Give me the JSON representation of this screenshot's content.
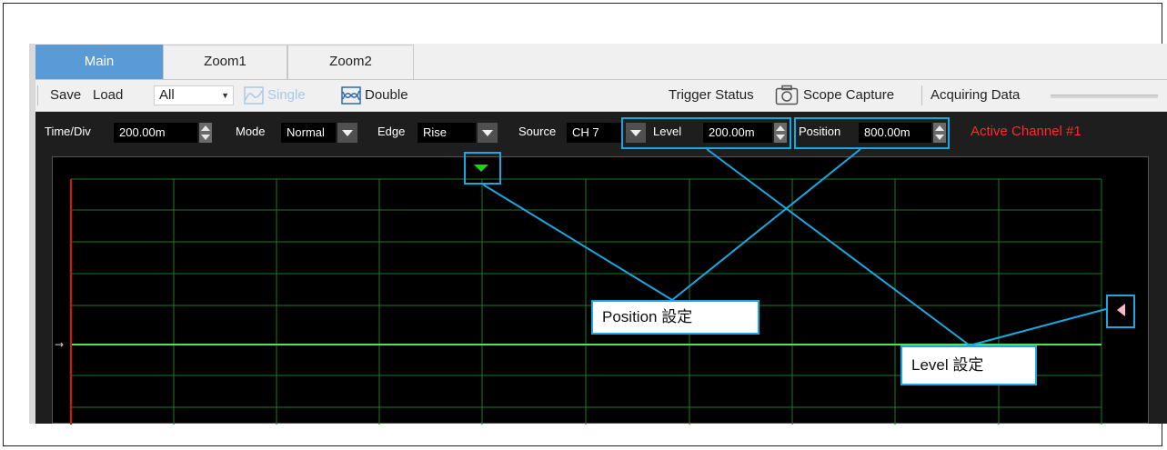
{
  "tabs": [
    "Main",
    "Zoom1",
    "Zoom2"
  ],
  "toolbar": {
    "save": "Save",
    "load": "Load",
    "load_filter": "All",
    "single": "Single",
    "double": "Double",
    "trigger_status": "Trigger Status",
    "scope_capture": "Scope Capture",
    "acquiring": "Acquiring Data"
  },
  "controls": {
    "time_div_label": "Time/Div",
    "time_div_value": "200.00m",
    "mode_label": "Mode",
    "mode_value": "Normal",
    "edge_label": "Edge",
    "edge_value": "Rise",
    "source_label": "Source",
    "source_value": "CH 7",
    "level_label": "Level",
    "level_value": "200.00m",
    "position_label": "Position",
    "position_value": "800.00m",
    "active_channel": "Active Channel #1"
  },
  "annotations": {
    "position_label": "Position 設定",
    "level_label": "Level 設定"
  },
  "colors": {
    "tab_active": "#5b9bd5",
    "grid": "#1f7a1f",
    "trace": "#55e055",
    "axis": "#dd1111",
    "callout": "#1ba7e1",
    "active_channel": "#ff2a2a"
  }
}
